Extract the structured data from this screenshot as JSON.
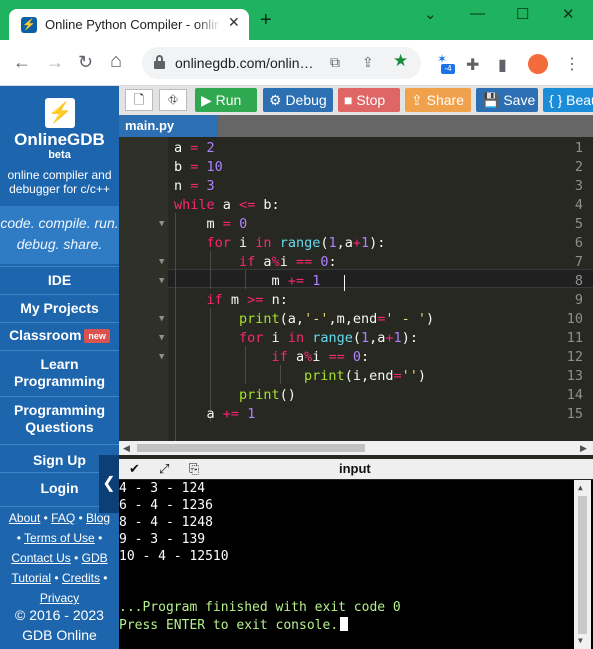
{
  "browser": {
    "tab_title": "Online Python Compiler - online",
    "tab_favicon": "⚡",
    "close_glyph": "✕",
    "new_tab_glyph": "+",
    "minimize_glyph": "⌄",
    "restore_glyph": "—",
    "maximize_glyph": "☐",
    "window_close_glyph": "✕",
    "back_glyph": "←",
    "forward_glyph": "→",
    "reload_glyph": "↻",
    "home_glyph": "⌂",
    "url": "onlinegdb.com/onlin…",
    "translate_glyph": "⧉",
    "share_glyph": "⇪",
    "star_glyph": "★",
    "extension_badge": "-4",
    "extension_glyph": "✶",
    "puzzle_glyph": "✚",
    "sidepanel_glyph": "▮",
    "menu_glyph": "⋮"
  },
  "sidebar": {
    "logo_glyph": "⚡",
    "brand": "OnlineGDB",
    "brand_sub": "beta",
    "description": "online compiler and debugger for c/c++",
    "tagline": "code. compile. run. debug. share.",
    "items": [
      {
        "label": "IDE"
      },
      {
        "label": "My Projects"
      },
      {
        "label": "Classroom",
        "badge": "new"
      },
      {
        "label": "Learn Programming"
      },
      {
        "label": "Programming Questions"
      },
      {
        "label": "Sign Up"
      },
      {
        "label": "Login"
      }
    ],
    "footer_links": [
      "About",
      "FAQ",
      "Blog",
      "Terms of Use",
      "Contact Us",
      "GDB",
      "Tutorial",
      "Credits",
      "Privacy"
    ],
    "copyright": "© 2016 - 2023",
    "company": "GDB Online",
    "collapse_glyph": "❮"
  },
  "toolbar": {
    "new_file_glyph": "🗋",
    "upload_glyph": "⛗",
    "run": "▶ Run",
    "debug": "⚙ Debug",
    "stop": "■ Stop",
    "share": "⇪ Share",
    "save": "💾 Save",
    "beautify": "{ } Beautify"
  },
  "colors": {
    "run": "#2fa84f",
    "debug": "#2d6fb3",
    "stop": "#e06666",
    "share": "#f0a14b",
    "save": "#2d6fb3",
    "beautify": "#1a8cd8"
  },
  "editor": {
    "file_tab": "main.py",
    "line_numbers": [
      "1",
      "2",
      "3",
      "4",
      "5",
      "6",
      "7",
      "8",
      "9",
      "10",
      "11",
      "12",
      "13",
      "14",
      "15"
    ],
    "active_line": 8
  },
  "io": {
    "title": "input",
    "check_glyph": "✔",
    "expand_glyph": "⤢",
    "copy_glyph": "⎘"
  },
  "console": {
    "output": [
      "4 - 3 - 124",
      "6 - 4 - 1236",
      "8 - 4 - 1248",
      "9 - 3 - 139",
      "10 - 4 - 12510"
    ],
    "finished": "...Program finished with exit code 0",
    "press_enter": "Press ENTER to exit console."
  }
}
